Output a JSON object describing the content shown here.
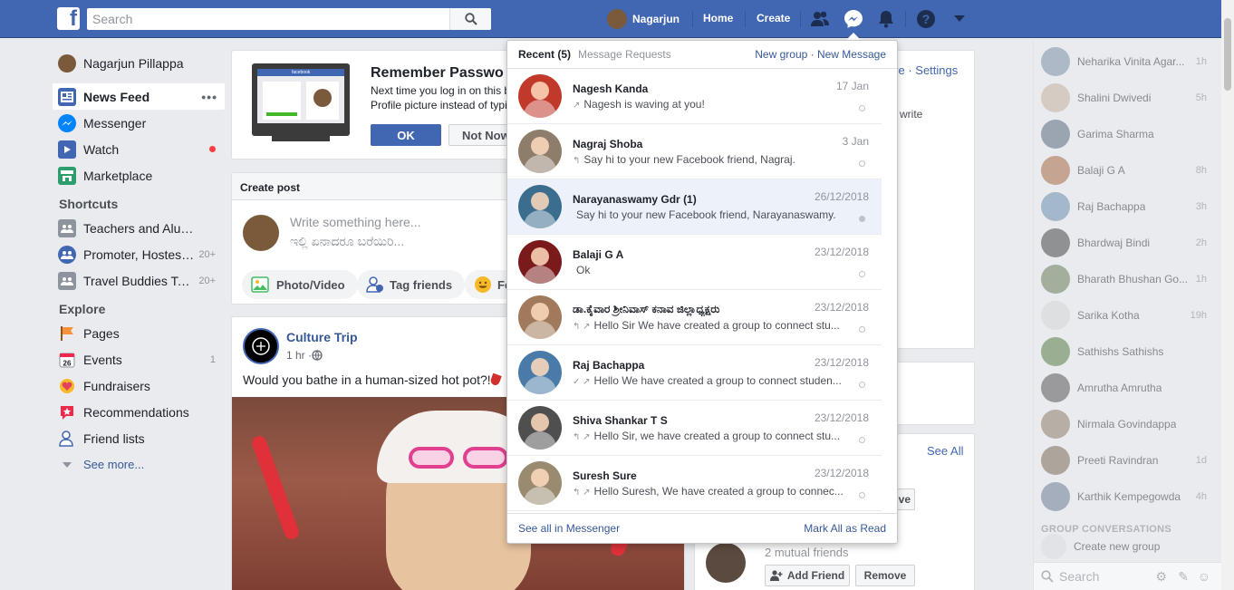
{
  "topbar": {
    "search_placeholder": "Search",
    "user_name": "Nagarjun",
    "home_label": "Home",
    "create_label": "Create"
  },
  "left_nav": {
    "profile_name": "Nagarjun Pillappa",
    "items": [
      {
        "label": "News Feed",
        "icon": "news-feed-icon"
      },
      {
        "label": "Messenger",
        "icon": "messenger-icon"
      },
      {
        "label": "Watch",
        "icon": "watch-icon"
      },
      {
        "label": "Marketplace",
        "icon": "marketplace-icon"
      }
    ],
    "shortcuts_heading": "Shortcuts",
    "shortcuts": [
      {
        "label": "Teachers and Alum...",
        "count": ""
      },
      {
        "label": "Promoter, Hostess...",
        "count": "20+"
      },
      {
        "label": "Travel Buddies Talk...",
        "count": "20+"
      }
    ],
    "explore_heading": "Explore",
    "explore": [
      {
        "label": "Pages",
        "count": ""
      },
      {
        "label": "Events",
        "count": "1"
      },
      {
        "label": "Fundraisers",
        "count": ""
      },
      {
        "label": "Recommendations",
        "count": ""
      },
      {
        "label": "Friend lists",
        "count": ""
      }
    ],
    "see_more": "See more..."
  },
  "remember_card": {
    "title": "Remember Passwo",
    "line1": "Next time you log in on this b",
    "line2": "Profile picture instead of typi",
    "ok_label": "OK",
    "not_now_label": "Not Now",
    "illustration_brand": "facebook"
  },
  "create_post": {
    "heading": "Create post",
    "placeholder_en": "Write something here...",
    "placeholder_kn": "ಇಲ್ಲಿ ಏನಾದರೂ ಬರೆಯಿರಿ...",
    "photo_label": "Photo/Video",
    "tag_label": "Tag friends",
    "feeling_label": "Fe"
  },
  "post": {
    "author": "Culture Trip",
    "time": "1 hr · ",
    "text": "Would you bathe in a human-sized hot pot?! "
  },
  "right_column": {
    "top_links": "ve · Settings",
    "write_text": "write",
    "see_all": "See All",
    "remove_partial": "ve",
    "mutual": "2 mutual friends",
    "add_friend": "Add Friend",
    "remove": "Remove"
  },
  "messenger_dropdown": {
    "recent_label": "Recent (5)",
    "requests_label": "Message Requests",
    "new_group": "New group",
    "sep": " · ",
    "new_message": "New Message",
    "see_all": "See all in Messenger",
    "mark_all": "Mark All as Read",
    "messages": [
      {
        "name": "Nagesh Kanda",
        "date": "17 Jan",
        "snippet": "Nagesh is waving at you!",
        "glyph": "↗",
        "unread": false,
        "color": "#c0392b"
      },
      {
        "name": "Nagraj Shoba",
        "date": "3 Jan",
        "snippet": "Say hi to your new Facebook friend, Nagraj.",
        "glyph": "↰",
        "unread": false,
        "color": "#8e7d6b"
      },
      {
        "name": "Narayanaswamy Gdr (1)",
        "date": "26/12/2018",
        "snippet": "Say hi to your new Facebook friend, Narayanaswamy.",
        "glyph": "",
        "unread": true,
        "color": "#3b6d8f"
      },
      {
        "name": "Balaji G A",
        "date": "23/12/2018",
        "snippet": "Ok",
        "glyph": "",
        "unread": false,
        "color": "#7b1a1a"
      },
      {
        "name": "ಡಾ.ಕೈವಾರ ಶ್ರೀನಿವಾಸ್ ಕನಾವ ಜಿಲ್ಲಾಧ್ಯಕ್ಷರು",
        "date": "23/12/2018",
        "snippet": "Hello Sir We have created a group to connect stu...",
        "glyph": "↰ ↗",
        "unread": false,
        "color": "#a07a5a"
      },
      {
        "name": "Raj Bachappa",
        "date": "23/12/2018",
        "snippet": "Hello We have created a group to connect studen...",
        "glyph": "✓ ↗",
        "unread": false,
        "color": "#4a7aa8"
      },
      {
        "name": "Shiva Shankar T S",
        "date": "23/12/2018",
        "snippet": "Hello Sir, we have created a group to connect stu...",
        "glyph": "↰ ↗",
        "unread": false,
        "color": "#4f4f4f"
      },
      {
        "name": "Suresh Sure",
        "date": "23/12/2018",
        "snippet": "Hello Suresh, We have created a group to connec...",
        "glyph": "↰ ↗",
        "unread": false,
        "color": "#9a8a70"
      }
    ]
  },
  "chat": {
    "contacts": [
      {
        "name": "Neharika Vinita Agar...",
        "time": "1h"
      },
      {
        "name": "Shalini Dwivedi",
        "time": "5h"
      },
      {
        "name": "Garima Sharma",
        "time": ""
      },
      {
        "name": "Balaji G A",
        "time": "8h"
      },
      {
        "name": "Raj Bachappa",
        "time": "3h"
      },
      {
        "name": "Bhardwaj Bindi",
        "time": "2h"
      },
      {
        "name": "Bharath Bhushan Go...",
        "time": "1h"
      },
      {
        "name": "Sarika Kotha",
        "time": "19h"
      },
      {
        "name": "Sathishs Sathishs",
        "time": ""
      },
      {
        "name": "Amrutha Amrutha",
        "time": ""
      },
      {
        "name": "Nirmala Govindappa",
        "time": ""
      },
      {
        "name": "Preeti Ravindran",
        "time": "1d"
      },
      {
        "name": "Karthik Kempegowda",
        "time": "4h"
      }
    ],
    "group_heading": "GROUP CONVERSATIONS",
    "create_group": "Create new group",
    "search_placeholder": "Search"
  }
}
